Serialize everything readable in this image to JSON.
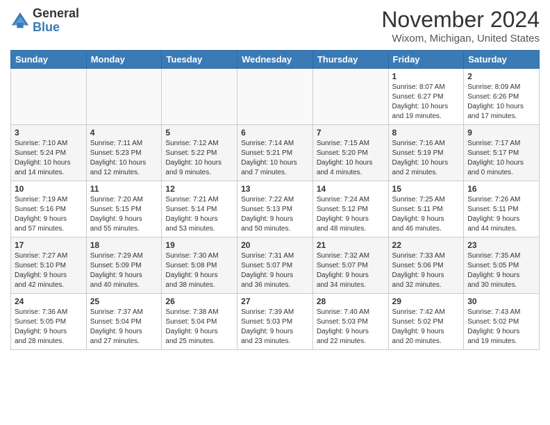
{
  "header": {
    "logo_general": "General",
    "logo_blue": "Blue",
    "month_title": "November 2024",
    "location": "Wixom, Michigan, United States"
  },
  "days_of_week": [
    "Sunday",
    "Monday",
    "Tuesday",
    "Wednesday",
    "Thursday",
    "Friday",
    "Saturday"
  ],
  "weeks": [
    [
      {
        "day": "",
        "info": ""
      },
      {
        "day": "",
        "info": ""
      },
      {
        "day": "",
        "info": ""
      },
      {
        "day": "",
        "info": ""
      },
      {
        "day": "",
        "info": ""
      },
      {
        "day": "1",
        "info": "Sunrise: 8:07 AM\nSunset: 6:27 PM\nDaylight: 10 hours\nand 19 minutes."
      },
      {
        "day": "2",
        "info": "Sunrise: 8:09 AM\nSunset: 6:26 PM\nDaylight: 10 hours\nand 17 minutes."
      }
    ],
    [
      {
        "day": "3",
        "info": "Sunrise: 7:10 AM\nSunset: 5:24 PM\nDaylight: 10 hours\nand 14 minutes."
      },
      {
        "day": "4",
        "info": "Sunrise: 7:11 AM\nSunset: 5:23 PM\nDaylight: 10 hours\nand 12 minutes."
      },
      {
        "day": "5",
        "info": "Sunrise: 7:12 AM\nSunset: 5:22 PM\nDaylight: 10 hours\nand 9 minutes."
      },
      {
        "day": "6",
        "info": "Sunrise: 7:14 AM\nSunset: 5:21 PM\nDaylight: 10 hours\nand 7 minutes."
      },
      {
        "day": "7",
        "info": "Sunrise: 7:15 AM\nSunset: 5:20 PM\nDaylight: 10 hours\nand 4 minutes."
      },
      {
        "day": "8",
        "info": "Sunrise: 7:16 AM\nSunset: 5:19 PM\nDaylight: 10 hours\nand 2 minutes."
      },
      {
        "day": "9",
        "info": "Sunrise: 7:17 AM\nSunset: 5:17 PM\nDaylight: 10 hours\nand 0 minutes."
      }
    ],
    [
      {
        "day": "10",
        "info": "Sunrise: 7:19 AM\nSunset: 5:16 PM\nDaylight: 9 hours\nand 57 minutes."
      },
      {
        "day": "11",
        "info": "Sunrise: 7:20 AM\nSunset: 5:15 PM\nDaylight: 9 hours\nand 55 minutes."
      },
      {
        "day": "12",
        "info": "Sunrise: 7:21 AM\nSunset: 5:14 PM\nDaylight: 9 hours\nand 53 minutes."
      },
      {
        "day": "13",
        "info": "Sunrise: 7:22 AM\nSunset: 5:13 PM\nDaylight: 9 hours\nand 50 minutes."
      },
      {
        "day": "14",
        "info": "Sunrise: 7:24 AM\nSunset: 5:12 PM\nDaylight: 9 hours\nand 48 minutes."
      },
      {
        "day": "15",
        "info": "Sunrise: 7:25 AM\nSunset: 5:11 PM\nDaylight: 9 hours\nand 46 minutes."
      },
      {
        "day": "16",
        "info": "Sunrise: 7:26 AM\nSunset: 5:11 PM\nDaylight: 9 hours\nand 44 minutes."
      }
    ],
    [
      {
        "day": "17",
        "info": "Sunrise: 7:27 AM\nSunset: 5:10 PM\nDaylight: 9 hours\nand 42 minutes."
      },
      {
        "day": "18",
        "info": "Sunrise: 7:29 AM\nSunset: 5:09 PM\nDaylight: 9 hours\nand 40 minutes."
      },
      {
        "day": "19",
        "info": "Sunrise: 7:30 AM\nSunset: 5:08 PM\nDaylight: 9 hours\nand 38 minutes."
      },
      {
        "day": "20",
        "info": "Sunrise: 7:31 AM\nSunset: 5:07 PM\nDaylight: 9 hours\nand 36 minutes."
      },
      {
        "day": "21",
        "info": "Sunrise: 7:32 AM\nSunset: 5:07 PM\nDaylight: 9 hours\nand 34 minutes."
      },
      {
        "day": "22",
        "info": "Sunrise: 7:33 AM\nSunset: 5:06 PM\nDaylight: 9 hours\nand 32 minutes."
      },
      {
        "day": "23",
        "info": "Sunrise: 7:35 AM\nSunset: 5:05 PM\nDaylight: 9 hours\nand 30 minutes."
      }
    ],
    [
      {
        "day": "24",
        "info": "Sunrise: 7:36 AM\nSunset: 5:05 PM\nDaylight: 9 hours\nand 28 minutes."
      },
      {
        "day": "25",
        "info": "Sunrise: 7:37 AM\nSunset: 5:04 PM\nDaylight: 9 hours\nand 27 minutes."
      },
      {
        "day": "26",
        "info": "Sunrise: 7:38 AM\nSunset: 5:04 PM\nDaylight: 9 hours\nand 25 minutes."
      },
      {
        "day": "27",
        "info": "Sunrise: 7:39 AM\nSunset: 5:03 PM\nDaylight: 9 hours\nand 23 minutes."
      },
      {
        "day": "28",
        "info": "Sunrise: 7:40 AM\nSunset: 5:03 PM\nDaylight: 9 hours\nand 22 minutes."
      },
      {
        "day": "29",
        "info": "Sunrise: 7:42 AM\nSunset: 5:02 PM\nDaylight: 9 hours\nand 20 minutes."
      },
      {
        "day": "30",
        "info": "Sunrise: 7:43 AM\nSunset: 5:02 PM\nDaylight: 9 hours\nand 19 minutes."
      }
    ]
  ]
}
